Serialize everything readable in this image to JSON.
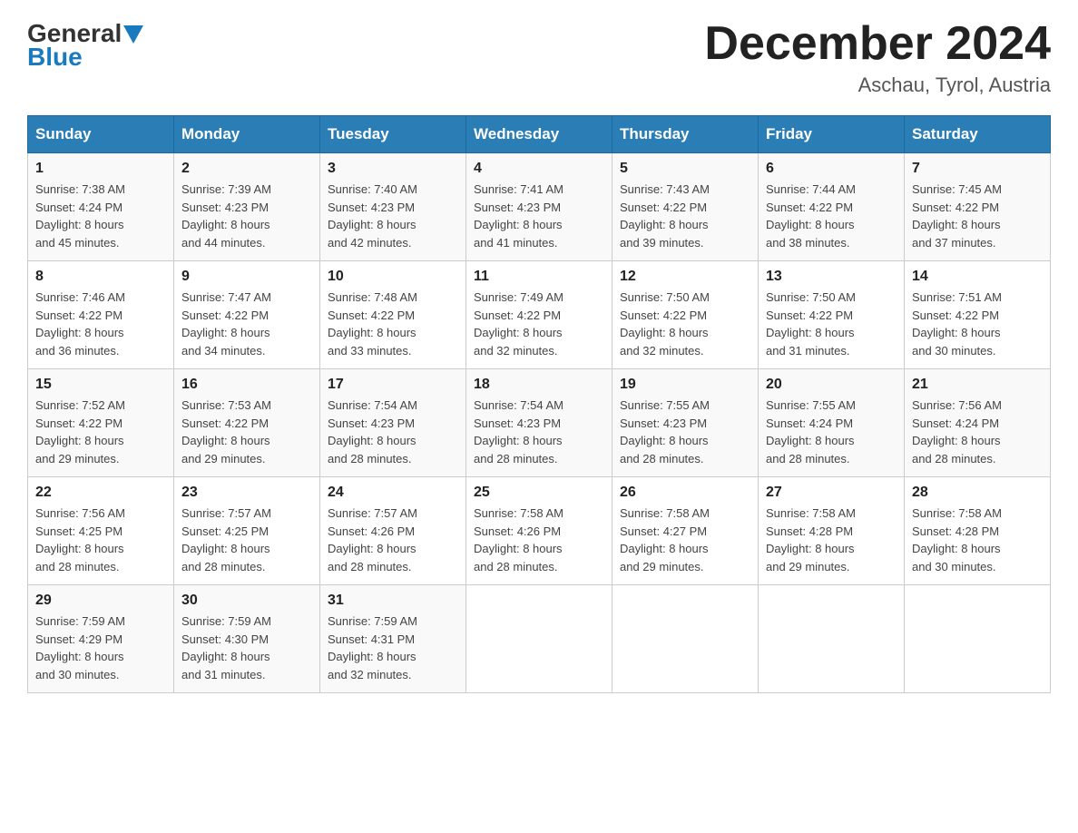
{
  "header": {
    "logo": {
      "general_text": "General",
      "blue_text": "Blue"
    },
    "title": "December 2024",
    "location": "Aschau, Tyrol, Austria"
  },
  "days_of_week": [
    "Sunday",
    "Monday",
    "Tuesday",
    "Wednesday",
    "Thursday",
    "Friday",
    "Saturday"
  ],
  "weeks": [
    [
      {
        "day": "1",
        "sunrise": "7:38 AM",
        "sunset": "4:24 PM",
        "daylight": "8 hours and 45 minutes."
      },
      {
        "day": "2",
        "sunrise": "7:39 AM",
        "sunset": "4:23 PM",
        "daylight": "8 hours and 44 minutes."
      },
      {
        "day": "3",
        "sunrise": "7:40 AM",
        "sunset": "4:23 PM",
        "daylight": "8 hours and 42 minutes."
      },
      {
        "day": "4",
        "sunrise": "7:41 AM",
        "sunset": "4:23 PM",
        "daylight": "8 hours and 41 minutes."
      },
      {
        "day": "5",
        "sunrise": "7:43 AM",
        "sunset": "4:22 PM",
        "daylight": "8 hours and 39 minutes."
      },
      {
        "day": "6",
        "sunrise": "7:44 AM",
        "sunset": "4:22 PM",
        "daylight": "8 hours and 38 minutes."
      },
      {
        "day": "7",
        "sunrise": "7:45 AM",
        "sunset": "4:22 PM",
        "daylight": "8 hours and 37 minutes."
      }
    ],
    [
      {
        "day": "8",
        "sunrise": "7:46 AM",
        "sunset": "4:22 PM",
        "daylight": "8 hours and 36 minutes."
      },
      {
        "day": "9",
        "sunrise": "7:47 AM",
        "sunset": "4:22 PM",
        "daylight": "8 hours and 34 minutes."
      },
      {
        "day": "10",
        "sunrise": "7:48 AM",
        "sunset": "4:22 PM",
        "daylight": "8 hours and 33 minutes."
      },
      {
        "day": "11",
        "sunrise": "7:49 AM",
        "sunset": "4:22 PM",
        "daylight": "8 hours and 32 minutes."
      },
      {
        "day": "12",
        "sunrise": "7:50 AM",
        "sunset": "4:22 PM",
        "daylight": "8 hours and 32 minutes."
      },
      {
        "day": "13",
        "sunrise": "7:50 AM",
        "sunset": "4:22 PM",
        "daylight": "8 hours and 31 minutes."
      },
      {
        "day": "14",
        "sunrise": "7:51 AM",
        "sunset": "4:22 PM",
        "daylight": "8 hours and 30 minutes."
      }
    ],
    [
      {
        "day": "15",
        "sunrise": "7:52 AM",
        "sunset": "4:22 PM",
        "daylight": "8 hours and 29 minutes."
      },
      {
        "day": "16",
        "sunrise": "7:53 AM",
        "sunset": "4:22 PM",
        "daylight": "8 hours and 29 minutes."
      },
      {
        "day": "17",
        "sunrise": "7:54 AM",
        "sunset": "4:23 PM",
        "daylight": "8 hours and 28 minutes."
      },
      {
        "day": "18",
        "sunrise": "7:54 AM",
        "sunset": "4:23 PM",
        "daylight": "8 hours and 28 minutes."
      },
      {
        "day": "19",
        "sunrise": "7:55 AM",
        "sunset": "4:23 PM",
        "daylight": "8 hours and 28 minutes."
      },
      {
        "day": "20",
        "sunrise": "7:55 AM",
        "sunset": "4:24 PM",
        "daylight": "8 hours and 28 minutes."
      },
      {
        "day": "21",
        "sunrise": "7:56 AM",
        "sunset": "4:24 PM",
        "daylight": "8 hours and 28 minutes."
      }
    ],
    [
      {
        "day": "22",
        "sunrise": "7:56 AM",
        "sunset": "4:25 PM",
        "daylight": "8 hours and 28 minutes."
      },
      {
        "day": "23",
        "sunrise": "7:57 AM",
        "sunset": "4:25 PM",
        "daylight": "8 hours and 28 minutes."
      },
      {
        "day": "24",
        "sunrise": "7:57 AM",
        "sunset": "4:26 PM",
        "daylight": "8 hours and 28 minutes."
      },
      {
        "day": "25",
        "sunrise": "7:58 AM",
        "sunset": "4:26 PM",
        "daylight": "8 hours and 28 minutes."
      },
      {
        "day": "26",
        "sunrise": "7:58 AM",
        "sunset": "4:27 PM",
        "daylight": "8 hours and 29 minutes."
      },
      {
        "day": "27",
        "sunrise": "7:58 AM",
        "sunset": "4:28 PM",
        "daylight": "8 hours and 29 minutes."
      },
      {
        "day": "28",
        "sunrise": "7:58 AM",
        "sunset": "4:28 PM",
        "daylight": "8 hours and 30 minutes."
      }
    ],
    [
      {
        "day": "29",
        "sunrise": "7:59 AM",
        "sunset": "4:29 PM",
        "daylight": "8 hours and 30 minutes."
      },
      {
        "day": "30",
        "sunrise": "7:59 AM",
        "sunset": "4:30 PM",
        "daylight": "8 hours and 31 minutes."
      },
      {
        "day": "31",
        "sunrise": "7:59 AM",
        "sunset": "4:31 PM",
        "daylight": "8 hours and 32 minutes."
      },
      null,
      null,
      null,
      null
    ]
  ],
  "labels": {
    "sunrise": "Sunrise:",
    "sunset": "Sunset:",
    "daylight": "Daylight:"
  },
  "colors": {
    "header_bg": "#2a7db5",
    "header_text": "#ffffff",
    "accent": "#1a7abf"
  }
}
